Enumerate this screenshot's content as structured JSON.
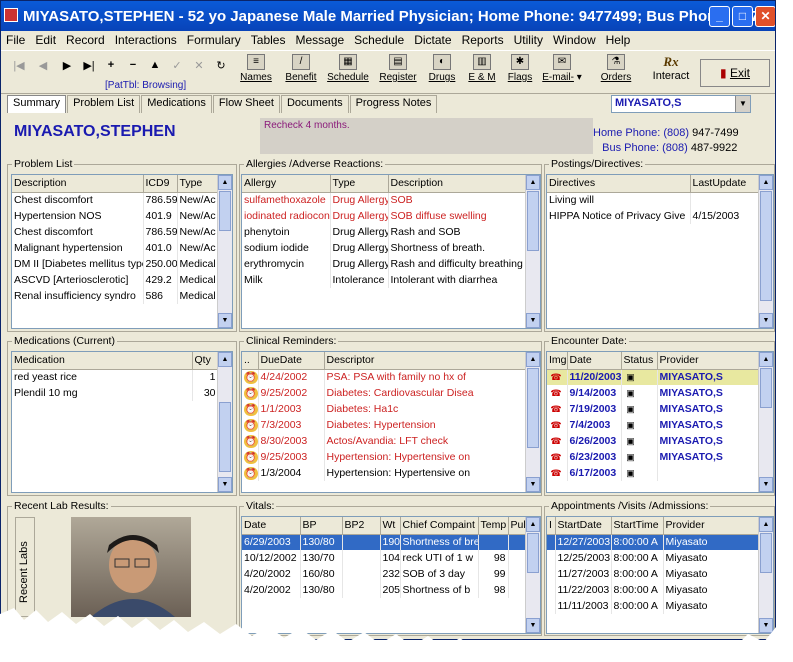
{
  "window": {
    "title": "MIYASATO,STEPHEN - 52 yo Japanese Male Married Physician; Home Phone: 9477499; Bus Phone: 4879922"
  },
  "menu": [
    "File",
    "Edit",
    "Record",
    "Interactions",
    "Formulary",
    "Tables",
    "Message",
    "Schedule",
    "Dictate",
    "Reports",
    "Utility",
    "Window",
    "Help"
  ],
  "toolbar": {
    "browsing": "[PatTbl: Browsing]",
    "names": "Names",
    "benefit": "Benefit",
    "schedule": "Schedule",
    "register": "Register",
    "drugs": "Drugs",
    "em": "E & M",
    "flags": "Flags",
    "email": "E-mail-",
    "orders": "Orders",
    "interact": "Interact",
    "exit": "Exit",
    "rx_icon": "Rx"
  },
  "tabs": [
    "Summary",
    "Problem List",
    "Medications",
    "Flow Sheet",
    "Documents",
    "Progress Notes"
  ],
  "patient_combo": "MIYASATO,S",
  "patient": {
    "name": "MIYASATO,STEPHEN",
    "note": "Recheck 4 months.",
    "home_label": "Home Phone:",
    "home_area": "(808)",
    "home_num": "947-7499",
    "bus_label": "Bus Phone:",
    "bus_area": "(808)",
    "bus_num": "487-9922"
  },
  "problem_list": {
    "title": "Problem List",
    "cols": [
      "Description",
      "ICD9",
      "Type"
    ],
    "rows": [
      [
        "Chest discomfort",
        "786.59",
        "New/Ac"
      ],
      [
        "Hypertension NOS",
        "401.9",
        "New/Ac"
      ],
      [
        "Chest discomfort",
        "786.59",
        "New/Ac"
      ],
      [
        "Malignant hypertension",
        "401.0",
        "New/Ac"
      ],
      [
        "DM II [Diabetes mellitus type",
        "250.00",
        "Medical"
      ],
      [
        "ASCVD [Arteriosclerotic]",
        "429.2",
        "Medical"
      ],
      [
        "Renal insufficiency syndro",
        "586",
        "Medical"
      ]
    ]
  },
  "allergies": {
    "title": "Allergies /Adverse Reactions:",
    "cols": [
      "Allergy",
      "Type",
      "Description"
    ],
    "rows": [
      [
        "sulfamethoxazole",
        "Drug Allergy",
        "SOB",
        "red"
      ],
      [
        "iodinated radiocon",
        "Drug Allergy",
        "SOB diffuse swelling",
        "red"
      ],
      [
        "phenytoin",
        "Drug Allergy",
        "Rash and SOB",
        ""
      ],
      [
        "sodium iodide",
        "Drug Allergy",
        "Shortness of breath.",
        ""
      ],
      [
        "erythromycin",
        "Drug Allergy",
        "Rash and difficulty breathing",
        ""
      ],
      [
        "Milk",
        "Intolerance",
        "Intolerant with diarrhea",
        ""
      ]
    ]
  },
  "postings": {
    "title": "Postings/Directives:",
    "cols": [
      "Directives",
      "LastUpdate"
    ],
    "rows": [
      [
        "Living will",
        ""
      ],
      [
        "HIPPA Notice of Privacy Give",
        "4/15/2003"
      ]
    ]
  },
  "medications": {
    "title": "Medications (Current)",
    "cols": [
      "Medication",
      "Qty"
    ],
    "rows": [
      [
        "red yeast rice",
        "1"
      ],
      [
        "Plendil 10 mg",
        "30"
      ]
    ]
  },
  "reminders": {
    "title": "Clinical Reminders:",
    "cols": [
      "..",
      "DueDate",
      "Descriptor"
    ],
    "rows": [
      [
        "4/24/2002",
        "PSA: PSA with family no hx of",
        "red"
      ],
      [
        "9/25/2002",
        "Diabetes: Cardiovascular Disea",
        "red"
      ],
      [
        "1/1/2003",
        "Diabetes: Ha1c",
        "red"
      ],
      [
        "7/3/2003",
        "Diabetes: Hypertension",
        "red"
      ],
      [
        "8/30/2003",
        "Actos/Avandia: LFT check",
        "red"
      ],
      [
        "9/25/2003",
        "Hypertension: Hypertensive on",
        "red"
      ],
      [
        "1/3/2004",
        "Hypertension: Hypertensive on",
        ""
      ]
    ]
  },
  "encounters": {
    "title": "Encounter Date:",
    "cols": [
      "Img",
      "Date",
      "Status",
      "Provider"
    ],
    "rows": [
      [
        "11/20/2003",
        "MIYASATO,S"
      ],
      [
        "9/14/2003",
        "MIYASATO,S"
      ],
      [
        "7/19/2003",
        "MIYASATO,S"
      ],
      [
        "7/4/2003",
        "MIYASATO,S"
      ],
      [
        "6/26/2003",
        "MIYASATO,S"
      ],
      [
        "6/23/2003",
        "MIYASATO,S"
      ],
      [
        "6/17/2003",
        ""
      ]
    ]
  },
  "labs": {
    "title": "Recent Lab Results:",
    "tab": "Recent Labs"
  },
  "vitals": {
    "title": "Vitals:",
    "cols": [
      "Date",
      "BP",
      "BP2",
      "Wt",
      "Chief Compaint",
      "Temp",
      "Pul"
    ],
    "rows": [
      [
        "6/29/2003",
        "130/80",
        "",
        "190",
        "Shortness of bre",
        ""
      ],
      [
        "10/12/2002",
        "130/70",
        "",
        "104",
        "reck UTI of 1 w",
        "98"
      ],
      [
        "4/20/2002",
        "160/80",
        "",
        "232",
        "SOB of 3 day",
        "99"
      ],
      [
        "4/20/2002",
        "130/80",
        "",
        "205",
        "Shortness of b",
        "98"
      ]
    ]
  },
  "appointments": {
    "title": "Appointments /Visits /Admissions:",
    "cols": [
      "I",
      "StartDate",
      "StartTime",
      "Provider"
    ],
    "rows": [
      [
        "12/27/2003",
        "8:00:00 A",
        "Miyasato"
      ],
      [
        "12/25/2003",
        "8:00:00 A",
        "Miyasato"
      ],
      [
        "11/27/2003",
        "8:00:00 A",
        "Miyasato"
      ],
      [
        "11/22/2003",
        "8:00:00 A",
        "Miyasato"
      ],
      [
        "11/11/2003",
        "8:00:00 A",
        "Miyasato"
      ]
    ]
  }
}
